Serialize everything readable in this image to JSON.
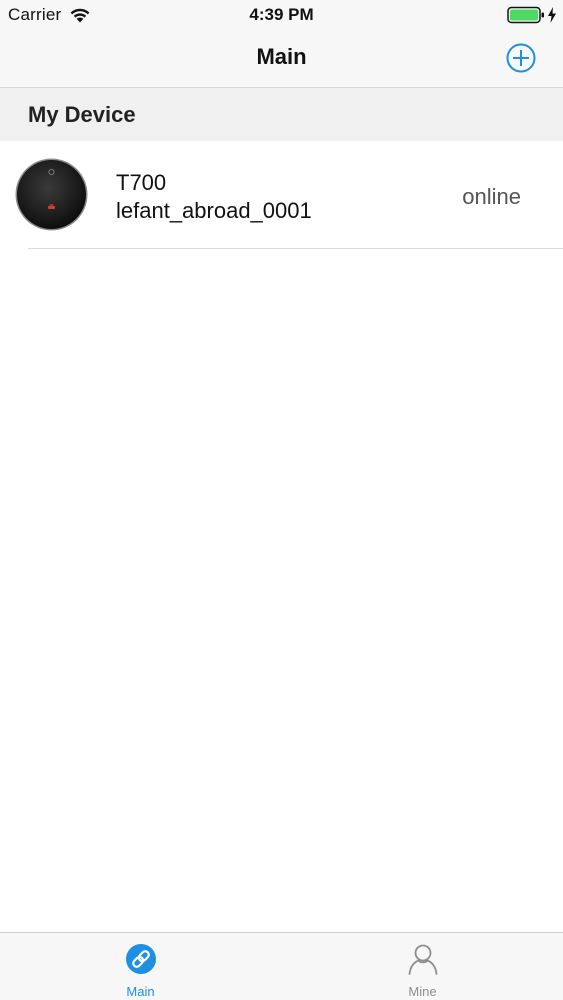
{
  "status_bar": {
    "carrier": "Carrier",
    "time": "4:39 PM",
    "icons": [
      "wifi-icon",
      "battery-icon",
      "charging-bolt-icon"
    ]
  },
  "nav": {
    "title": "Main",
    "add_icon": "plus-circle-icon"
  },
  "section": {
    "title": "My Device"
  },
  "devices": [
    {
      "name": "T700",
      "id": "lefant_abroad_0001",
      "status": "online",
      "thumb_icon": "robot-vacuum-icon"
    }
  ],
  "tab_bar": {
    "tabs": [
      {
        "label": "Main",
        "icon": "link-icon",
        "selected": true
      },
      {
        "label": "Mine",
        "icon": "person-icon",
        "selected": false
      }
    ]
  },
  "colors": {
    "accent": "#1e8fe1",
    "battery_green": "#4cd964",
    "inactive_tab": "#8e8e8e",
    "section_bg": "#f0f0f0",
    "bar_bg": "#f7f7f7"
  }
}
